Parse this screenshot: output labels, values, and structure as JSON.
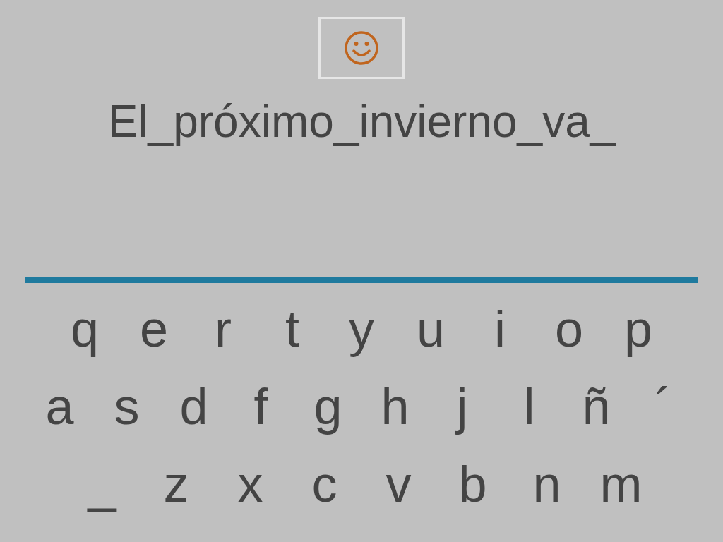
{
  "sentence": "El_próximo_invierno_va_",
  "keyboard": {
    "rows": [
      [
        "q",
        "e",
        "r",
        "t",
        "y",
        "u",
        "i",
        "o",
        "p"
      ],
      [
        "a",
        "s",
        "d",
        "f",
        "g",
        "h",
        "j",
        "l",
        "ñ",
        "´"
      ],
      [
        "_",
        "z",
        "x",
        "c",
        "v",
        "b",
        "n",
        "m"
      ]
    ]
  }
}
